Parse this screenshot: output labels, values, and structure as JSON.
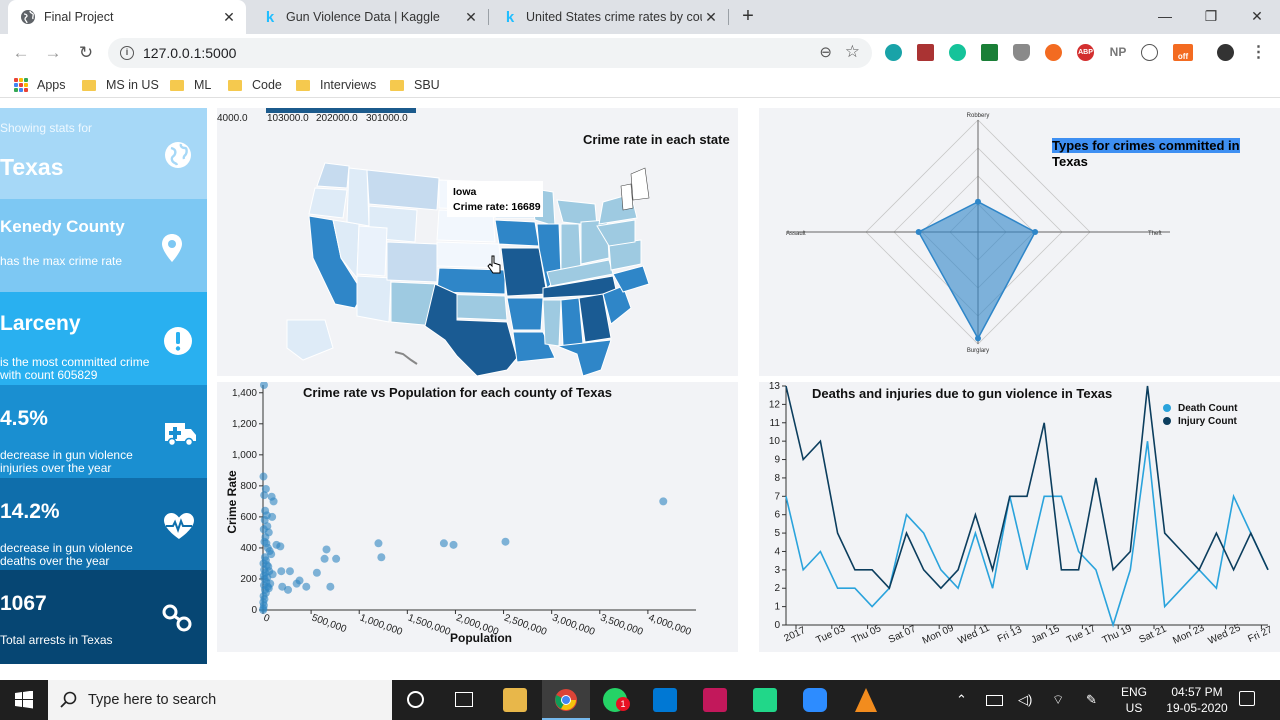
{
  "browser": {
    "tabs": [
      {
        "title": "Final Project",
        "icon": "globe-icon"
      },
      {
        "title": "Gun Violence Data | Kaggle",
        "icon": "kaggle-icon"
      },
      {
        "title": "United States crime rates by cou",
        "icon": "kaggle-icon"
      }
    ],
    "url": "127.0.0.1:5000",
    "bookmarks": [
      "Apps",
      "MS in US",
      "ML",
      "Code",
      "Interviews",
      "SBU"
    ],
    "extension_labels": {
      "np": "NP",
      "abp": "ABP",
      "off": "off"
    }
  },
  "stats": [
    {
      "top": "Showing stats for",
      "big": "Texas",
      "small": "",
      "icon": "globe-icon",
      "color": "#a6d8f7"
    },
    {
      "top": "",
      "big": "Kenedy County",
      "small": "has the max crime rate",
      "icon": "map-pin-icon",
      "color": "#7dc8f3"
    },
    {
      "top": "",
      "big": "Larceny",
      "small": "is the most committed crime with count 605829",
      "icon": "exclamation-icon",
      "color": "#29b0f0"
    },
    {
      "top": "",
      "big": "4.5%",
      "small": "decrease in gun violence injuries over the year",
      "icon": "ambulance-icon",
      "color": "#1a8fd1"
    },
    {
      "top": "",
      "big": "14.2%",
      "small": "decrease in gun violence deaths over the year",
      "icon": "heartbeat-icon",
      "color": "#0f6eab"
    },
    {
      "top": "",
      "big": "1067",
      "small": "Total arrests in Texas",
      "icon": "handcuffs-icon",
      "color": "#064673"
    }
  ],
  "map_panel": {
    "title": "Crime rate in each state",
    "legend_ticks": [
      "4000.0",
      "103000.0",
      "202000.0",
      "301000.0"
    ],
    "tooltip_state": "Iowa",
    "tooltip_value": "Crime rate: 16689"
  },
  "radar_panel": {
    "title_highlight": "Types for crimes committed in",
    "title_rest": "Texas",
    "axes": [
      "Robbery",
      "Assault",
      "Burglary",
      "Theft"
    ],
    "values": [
      0.27,
      0.53,
      0.95,
      0.51
    ],
    "color": "#2f86c8"
  },
  "chart_data": [
    {
      "type": "scatter",
      "title": "Crime rate vs Population for each county of Texas",
      "xlabel": "Population",
      "ylabel": "Crime Rate",
      "xlim": [
        0,
        4500000
      ],
      "ylim": [
        0,
        1450
      ],
      "x_ticks": [
        "0",
        "500,000",
        "1,000,000",
        "1,500,000",
        "2,000,000",
        "2,500,000",
        "3,000,000",
        "3,500,000",
        "4,000,000"
      ],
      "y_ticks": [
        "0",
        "200",
        "400",
        "600",
        "800",
        "1,000",
        "1,200",
        "1,400"
      ],
      "color": "#2e86c1",
      "points": [
        [
          10000,
          1450
        ],
        [
          5000,
          860
        ],
        [
          30000,
          780
        ],
        [
          12000,
          740
        ],
        [
          90000,
          730
        ],
        [
          110000,
          700
        ],
        [
          22000,
          640
        ],
        [
          40000,
          610
        ],
        [
          95000,
          600
        ],
        [
          18000,
          580
        ],
        [
          45000,
          540
        ],
        [
          8000,
          520
        ],
        [
          60000,
          500
        ],
        [
          25000,
          470
        ],
        [
          15000,
          440
        ],
        [
          35000,
          430
        ],
        [
          140000,
          420
        ],
        [
          180000,
          410
        ],
        [
          50000,
          400
        ],
        [
          70000,
          380
        ],
        [
          85000,
          360
        ],
        [
          20000,
          340
        ],
        [
          30000,
          320
        ],
        [
          5000,
          300
        ],
        [
          40000,
          290
        ],
        [
          55000,
          280
        ],
        [
          12000,
          260
        ],
        [
          65000,
          250
        ],
        [
          25000,
          240
        ],
        [
          190000,
          250
        ],
        [
          280000,
          250
        ],
        [
          8000,
          220
        ],
        [
          45000,
          210
        ],
        [
          15000,
          200
        ],
        [
          35000,
          180
        ],
        [
          75000,
          170
        ],
        [
          10000,
          160
        ],
        [
          50000,
          150
        ],
        [
          20000,
          130
        ],
        [
          30000,
          110
        ],
        [
          6000,
          90
        ],
        [
          15000,
          70
        ],
        [
          3000,
          50
        ],
        [
          9000,
          30
        ],
        [
          4000,
          10
        ],
        [
          2000,
          0
        ],
        [
          60000,
          140
        ],
        [
          100000,
          230
        ],
        [
          380000,
          190
        ],
        [
          260000,
          130
        ],
        [
          350000,
          170
        ],
        [
          450000,
          150
        ],
        [
          200000,
          150
        ],
        [
          560000,
          240
        ],
        [
          640000,
          330
        ],
        [
          660000,
          390
        ],
        [
          700000,
          150
        ],
        [
          760000,
          330
        ],
        [
          1230000,
          340
        ],
        [
          1200000,
          430
        ],
        [
          1880000,
          430
        ],
        [
          1980000,
          420
        ],
        [
          2520000,
          440
        ],
        [
          4160000,
          700
        ]
      ]
    },
    {
      "type": "line",
      "title": "Deaths and injuries due to gun violence in Texas",
      "x_ticks": [
        "2017",
        "Tue 03",
        "Thu 05",
        "Sat 07",
        "Mon 09",
        "Wed 11",
        "Fri 13",
        "Jan 15",
        "Tue 17",
        "Thu 19",
        "Sat 21",
        "Mon 23",
        "Wed 25",
        "Fri 27"
      ],
      "ylim": [
        0,
        13
      ],
      "y_ticks": [
        "0",
        "1",
        "2",
        "3",
        "4",
        "5",
        "6",
        "7",
        "8",
        "9",
        "10",
        "11",
        "12",
        "13"
      ],
      "series": [
        {
          "name": "Death Count",
          "color": "#2aa3dc",
          "values": [
            7,
            3,
            4,
            2,
            2,
            1,
            2,
            6,
            5,
            3,
            2,
            5,
            2,
            7,
            3,
            7,
            7,
            4,
            3,
            0,
            3,
            10,
            1,
            2,
            3,
            2,
            7,
            5,
            3
          ]
        },
        {
          "name": "Injury Count",
          "color": "#0c3e5e",
          "values": [
            13,
            9,
            10,
            5,
            3,
            3,
            2,
            5,
            3,
            2,
            3,
            6,
            3,
            7,
            7,
            11,
            3,
            3,
            8,
            3,
            4,
            13,
            5,
            4,
            3,
            5,
            3,
            5,
            3
          ]
        }
      ]
    }
  ],
  "taskbar": {
    "search_placeholder": "Type here to search",
    "lang1": "ENG",
    "lang2": "US",
    "time": "04:57 PM",
    "date": "19-05-2020",
    "whatsapp_badge": "1"
  }
}
